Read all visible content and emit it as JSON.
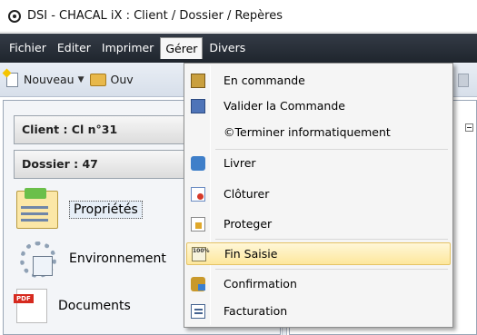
{
  "window": {
    "title": "DSI - CHACAL iX : Client / Dossier / Repères"
  },
  "menubar": {
    "items": [
      {
        "label": "Fichier"
      },
      {
        "label": "Editer"
      },
      {
        "label": "Imprimer"
      },
      {
        "label": "Gérer"
      },
      {
        "label": "Divers"
      }
    ],
    "active": "Gérer"
  },
  "toolbar": {
    "new_label": "Nouveau",
    "open_label": "Ouv"
  },
  "leftpanel": {
    "client_label": "Client : Cl n°31",
    "dossier_label": "Dossier : 47",
    "nav": [
      {
        "label": "Propriétés",
        "icon": "properties-icon"
      },
      {
        "label": "Environnement",
        "icon": "environment-icon"
      },
      {
        "label": "Documents",
        "icon": "pdf-icon"
      }
    ]
  },
  "dropdown": {
    "items": [
      {
        "label": "En commande",
        "icon": "box-icon"
      },
      {
        "label": "Valider la Commande",
        "icon": "validate-icon"
      },
      {
        "label": "©Terminer informatiquement",
        "icon": ""
      },
      {
        "label": "Livrer",
        "icon": "truck-icon"
      },
      {
        "label": "Clôturer",
        "icon": "close-folder-icon"
      },
      {
        "label": "Proteger",
        "icon": "lock-icon"
      },
      {
        "label": "Fin Saisie",
        "icon": "percent-icon",
        "highlighted": true
      },
      {
        "label": "Confirmation",
        "icon": "confirm-icon"
      },
      {
        "label": "Facturation",
        "icon": "invoice-icon"
      }
    ],
    "icon_percent_text": "100%"
  },
  "colors": {
    "menubar_bg": "#1f252d",
    "highlight_bg": "#fde79c",
    "highlight_border": "#e5c365"
  }
}
